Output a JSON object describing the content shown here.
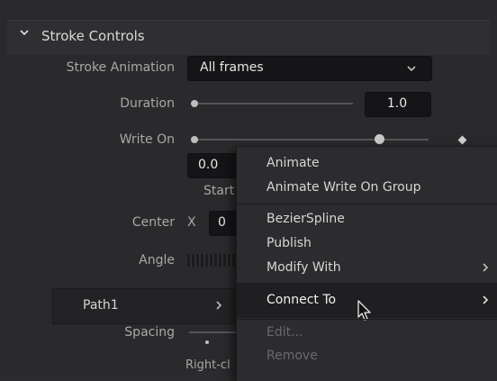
{
  "section": {
    "title": "Stroke Controls"
  },
  "stroke_animation": {
    "label": "Stroke Animation",
    "value": "All frames"
  },
  "duration": {
    "label": "Duration",
    "value": "1.0"
  },
  "write_on": {
    "label": "Write On",
    "start_value": "0.0",
    "start_label": "Start"
  },
  "center": {
    "label": "Center",
    "x_label": "X",
    "x_value": "0"
  },
  "angle": {
    "label": "Angle"
  },
  "path_row": {
    "label": "Path1"
  },
  "spacing": {
    "label": "Spacing"
  },
  "hint": {
    "text": "Right-cl"
  },
  "context_menu": {
    "items": [
      {
        "label": "Animate",
        "enabled": true,
        "submenu": false
      },
      {
        "label": "Animate Write On Group",
        "enabled": true,
        "submenu": false
      },
      {
        "label": "BezierSpline",
        "enabled": true,
        "submenu": false
      },
      {
        "label": "Publish",
        "enabled": true,
        "submenu": false
      },
      {
        "label": "Modify With",
        "enabled": true,
        "submenu": true
      },
      {
        "label": "Connect To",
        "enabled": true,
        "submenu": true,
        "highlighted": true
      },
      {
        "label": "Edit...",
        "enabled": false,
        "submenu": false
      },
      {
        "label": "Remove",
        "enabled": false,
        "submenu": false
      }
    ]
  },
  "icons": {
    "collapse": "chevron-down-icon",
    "dropdown": "chevron-down-icon",
    "submenu": "chevron-right-icon",
    "cursor": "mouse-cursor-icon"
  }
}
